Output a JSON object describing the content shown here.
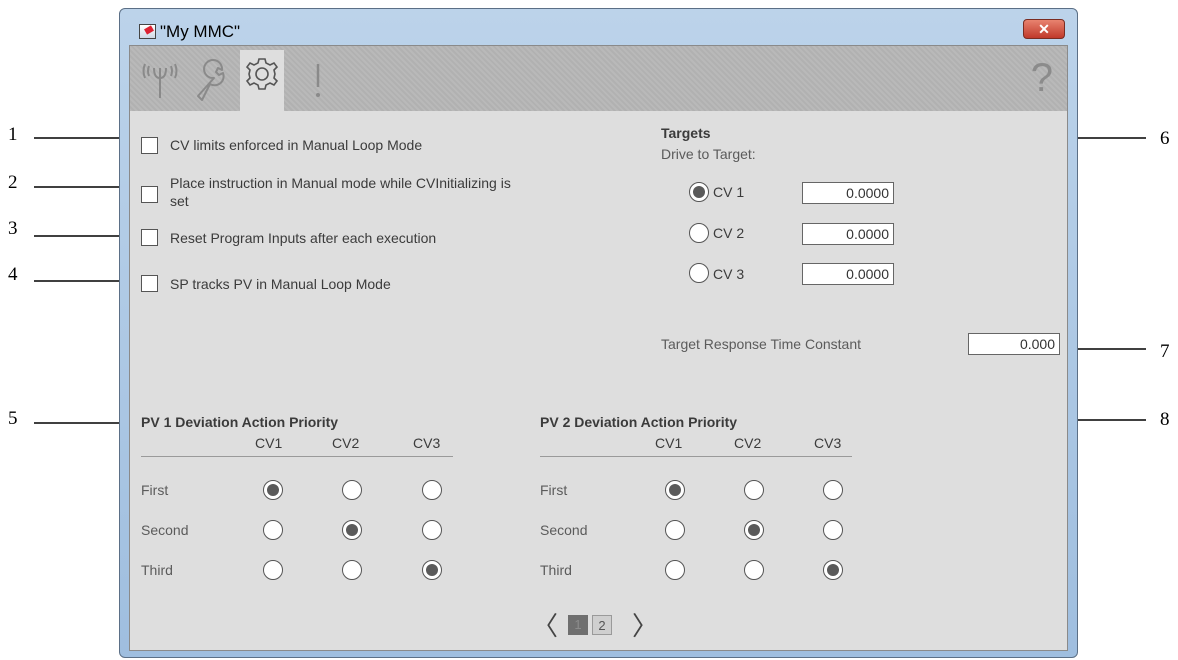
{
  "window": {
    "title": "\"My MMC\"",
    "close_label": "✕"
  },
  "toolbar": {
    "help_label": "?"
  },
  "callouts": [
    "1",
    "2",
    "3",
    "4",
    "5",
    "6",
    "7",
    "8"
  ],
  "options": [
    {
      "label": "CV limits enforced in Manual Loop Mode",
      "checked": false
    },
    {
      "label": "Place instruction in Manual mode while CVInitializing is",
      "label2": "set",
      "checked": false
    },
    {
      "label": "Reset Program Inputs after each execution",
      "checked": false
    },
    {
      "label": "SP tracks PV in Manual Loop Mode",
      "checked": false
    }
  ],
  "targets": {
    "heading": "Targets",
    "subheading": "Drive to Target:",
    "items": [
      {
        "label": "CV 1",
        "value": "0.0000",
        "selected": true
      },
      {
        "label": "CV 2",
        "value": "0.0000",
        "selected": false
      },
      {
        "label": "CV 3",
        "value": "0.0000",
        "selected": false
      }
    ],
    "response_label": "Target Response Time Constant",
    "response_value": "0.000"
  },
  "pv1": {
    "title": "PV 1 Deviation Action Priority",
    "columns": [
      "CV1",
      "CV2",
      "CV3"
    ],
    "rows": [
      {
        "label": "First",
        "selected": 0
      },
      {
        "label": "Second",
        "selected": 1
      },
      {
        "label": "Third",
        "selected": 2
      }
    ]
  },
  "pv2": {
    "title": "PV 2 Deviation Action Priority",
    "columns": [
      "CV1",
      "CV2",
      "CV3"
    ],
    "rows": [
      {
        "label": "First",
        "selected": 0
      },
      {
        "label": "Second",
        "selected": 1
      },
      {
        "label": "Third",
        "selected": 2
      }
    ]
  },
  "pager": {
    "prev": "〈",
    "next": "〉",
    "pages": [
      "1",
      "2"
    ],
    "current": "1"
  }
}
